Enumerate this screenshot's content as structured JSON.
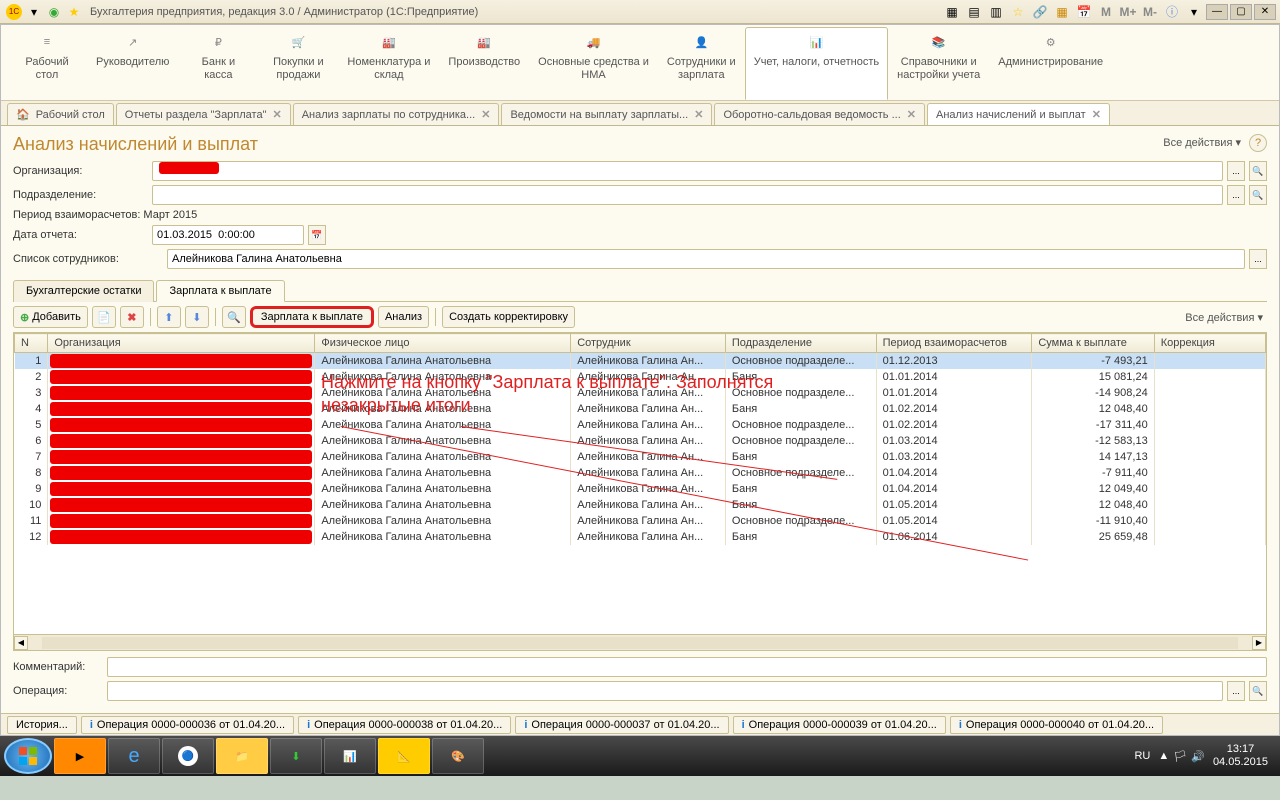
{
  "titlebar": {
    "title": "Бухгалтерия предприятия, редакция 3.0 / Администратор  (1С:Предприятие)",
    "m_btns": [
      "M",
      "M+",
      "M-"
    ]
  },
  "sections": [
    {
      "icon": "≡",
      "label": "Рабочий стол"
    },
    {
      "icon": "↗",
      "label": "Руководителю"
    },
    {
      "icon": "₽",
      "label": "Банк и касса"
    },
    {
      "icon": "🛒",
      "label": "Покупки и продажи"
    },
    {
      "icon": "🏭",
      "label": "Номенклатура и склад"
    },
    {
      "icon": "🏭",
      "label": "Производство"
    },
    {
      "icon": "🚚",
      "label": "Основные средства и НМА"
    },
    {
      "icon": "👤",
      "label": "Сотрудники и зарплата"
    },
    {
      "icon": "📊",
      "label": "Учет, налоги, отчетность",
      "active": true
    },
    {
      "icon": "📚",
      "label": "Справочники и настройки учета"
    },
    {
      "icon": "⚙",
      "label": "Администрирование"
    }
  ],
  "tabs": [
    {
      "label": "Рабочий стол",
      "closable": false,
      "icon": true
    },
    {
      "label": "Отчеты раздела \"Зарплата\"",
      "closable": true
    },
    {
      "label": "Анализ зарплаты по сотрудника...",
      "closable": true
    },
    {
      "label": "Ведомости на выплату зарплаты...",
      "closable": true
    },
    {
      "label": "Оборотно-сальдовая ведомость ...",
      "closable": true
    },
    {
      "label": "Анализ начислений и выплат",
      "closable": true,
      "active": true
    }
  ],
  "page": {
    "title": "Анализ начислений и выплат",
    "all_actions": "Все действия ▾",
    "help_icon": "?",
    "org_label": "Организация:",
    "subdiv_label": "Подразделение:",
    "period_text": "Период взаиморасчетов: Март 2015",
    "date_label": "Дата отчета:",
    "date_value": "01.03.2015  0:00:00",
    "employees_label": "Список сотрудников:",
    "employees_value": "Алейникова Галина Анатольевна",
    "comment_label": "Комментарий:",
    "operation_label": "Операция:",
    "annotation_l1": "Нажмите на кнопку \"Зарплата к выплате\". Заполнятся",
    "annotation_l2": "незакрытые итоги"
  },
  "sub_tabs": [
    {
      "label": "Бухгалтерские остатки"
    },
    {
      "label": "Зарплата к выплате",
      "active": true
    }
  ],
  "toolbar": {
    "add": "Добавить",
    "salary": "Зарплата к выплате",
    "analysis": "Анализ",
    "create_corr": "Создать корректировку",
    "all_actions": "Все действия ▾"
  },
  "table": {
    "headers": [
      "N",
      "Организация",
      "Физическое лицо",
      "Сотрудник",
      "Подразделение",
      "Период взаиморасчетов",
      "Сумма к выплате",
      "Коррекция"
    ],
    "rows": [
      {
        "n": 1,
        "fio": "Алейникова Галина Анатольевна",
        "emp": "Алейникова Галина Ан...",
        "dept": "Основное подразделе...",
        "period": "01.12.2013",
        "sum": "-7 493,21",
        "sel": true
      },
      {
        "n": 2,
        "fio": "Алейникова Галина Анатольевна",
        "emp": "Алейникова Галина Ан...",
        "dept": "Баня",
        "period": "01.01.2014",
        "sum": "15 081,24"
      },
      {
        "n": 3,
        "fio": "Алейникова Галина Анатольевна",
        "emp": "Алейникова Галина Ан...",
        "dept": "Основное подразделе...",
        "period": "01.01.2014",
        "sum": "-14 908,24"
      },
      {
        "n": 4,
        "fio": "Алейникова Галина Анатольевна",
        "emp": "Алейникова Галина Ан...",
        "dept": "Баня",
        "period": "01.02.2014",
        "sum": "12 048,40"
      },
      {
        "n": 5,
        "fio": "Алейникова Галина Анатольевна",
        "emp": "Алейникова Галина Ан...",
        "dept": "Основное подразделе...",
        "period": "01.02.2014",
        "sum": "-17 311,40"
      },
      {
        "n": 6,
        "fio": "Алейникова Галина Анатольевна",
        "emp": "Алейникова Галина Ан...",
        "dept": "Основное подразделе...",
        "period": "01.03.2014",
        "sum": "-12 583,13"
      },
      {
        "n": 7,
        "fio": "Алейникова Галина Анатольевна",
        "emp": "Алейникова Галина Ан...",
        "dept": "Баня",
        "period": "01.03.2014",
        "sum": "14 147,13"
      },
      {
        "n": 8,
        "fio": "Алейникова Галина Анатольевна",
        "emp": "Алейникова Галина Ан...",
        "dept": "Основное подразделе...",
        "period": "01.04.2014",
        "sum": "-7 911,40"
      },
      {
        "n": 9,
        "fio": "Алейникова Галина Анатольевна",
        "emp": "Алейникова Галина Ан...",
        "dept": "Баня",
        "period": "01.04.2014",
        "sum": "12 049,40"
      },
      {
        "n": 10,
        "fio": "Алейникова Галина Анатольевна",
        "emp": "Алейникова Галина Ан...",
        "dept": "Баня",
        "period": "01.05.2014",
        "sum": "12 048,40"
      },
      {
        "n": 11,
        "fio": "Алейникова Галина Анатольевна",
        "emp": "Алейникова Галина Ан...",
        "dept": "Основное подразделе...",
        "period": "01.05.2014",
        "sum": "-11 910,40"
      },
      {
        "n": 12,
        "fio": "Алейникова Галина Анатольевна",
        "emp": "Алейникова Галина Ан...",
        "dept": "Баня",
        "period": "01.06.2014",
        "sum": "25 659,48",
        "cut": true
      }
    ]
  },
  "bottom": {
    "history": "История...",
    "ops": [
      "Операция 0000-000036 от 01.04.20...",
      "Операция 0000-000038 от 01.04.20...",
      "Операция 0000-000037 от 01.04.20...",
      "Операция 0000-000039 от 01.04.20...",
      "Операция 0000-000040 от 01.04.20..."
    ]
  },
  "taskbar": {
    "lang": "RU",
    "time": "13:17",
    "date": "04.05.2015"
  }
}
